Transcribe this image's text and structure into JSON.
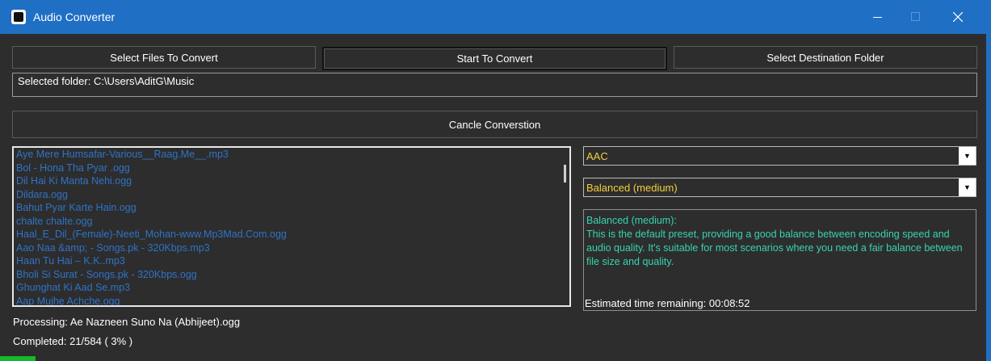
{
  "window": {
    "title": "Audio Converter"
  },
  "toolbar": {
    "select_files": "Select Files To Convert",
    "start": "Start To Convert",
    "select_destination": "Select Destination Folder"
  },
  "folder": {
    "text": "Selected folder: C:\\Users\\AditG\\Music"
  },
  "cancel": {
    "label": "Cancle Converstion"
  },
  "files": [
    "Aye Mere Humsafar-Various__Raag.Me__.mp3",
    "Bol - Hona Tha Pyar .ogg",
    "Dil Hai Ki Manta Nehi.ogg",
    "Dildara.ogg",
    "Bahut Pyar Karte Hain.ogg",
    "chalte chalte.ogg",
    "Haal_E_Dil_(Female)-Neeti_Mohan-www.Mp3Mad.Com.ogg",
    "Aao Naa &amp;  - Songs.pk - 320Kbps.mp3",
    "Haan Tu Hai – K.K..mp3",
    "Bholi Si Surat - Songs.pk - 320Kbps.ogg",
    "Ghunghat Ki Aad Se.mp3",
    "Aap Mujhe Achche.ogg"
  ],
  "format": {
    "selected": "AAC"
  },
  "preset": {
    "selected": "Balanced (medium)"
  },
  "description": "Balanced (medium):\nThis is the default preset, providing a good balance between encoding speed and audio quality. It's suitable for most scenarios where you need a fair balance between file size and quality.",
  "eta": "Estimated time remaining: 00:08:52",
  "status": {
    "processing": "Processing: Ae Nazneen Suno Na (Abhijeet).ogg",
    "completed": "Completed: 21/584 ( 3% )"
  },
  "progress": {
    "fraction": 0.036
  },
  "colors": {
    "titlebar": "#1f6fc5",
    "file_text": "#2f73c6",
    "select_text": "#f2cf3d",
    "desc_text": "#37d4b0",
    "progress": "#17b82e"
  }
}
